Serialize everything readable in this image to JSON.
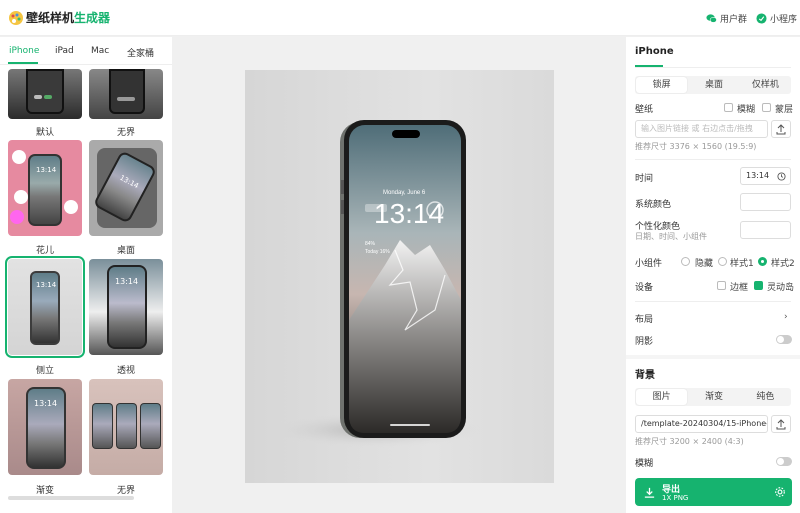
{
  "app": {
    "title_a": "壁纸样机",
    "title_b": "生成器",
    "user_group": "用户群",
    "mini_program": "小程序"
  },
  "device_tabs": [
    "iPhone",
    "iPad",
    "Mac",
    "全家桶"
  ],
  "templates": [
    {
      "label": "默认"
    },
    {
      "label": "无界"
    },
    {
      "label": "花儿"
    },
    {
      "label": "桌面"
    },
    {
      "label": "侧立"
    },
    {
      "label": "透视"
    },
    {
      "label": "渐变"
    },
    {
      "label": "无界"
    }
  ],
  "phone": {
    "date": "Monday, June 6",
    "time": "13:14",
    "battery": "84%",
    "weather": "Today 16%"
  },
  "thumb_time": "13:14",
  "panel": {
    "title": "iPhone",
    "modes": [
      "锁屏",
      "桌面",
      "仅样机"
    ],
    "wallpaper_label": "壁纸",
    "blur_label": "模糊",
    "mask_label": "蒙层",
    "wallpaper_placeholder": "输入图片链接 或 右边点击/拖拽",
    "wallpaper_hint": "推荐尺寸 3376 × 1560 (19.5:9)",
    "time_label": "时间",
    "time_value": "13:14",
    "system_color_label": "系统颜色",
    "custom_color_label": "个性化颜色",
    "custom_color_sub": "日期、时间、小组件",
    "widget_label": "小组件",
    "widget_options": [
      "隐藏",
      "样式1",
      "样式2"
    ],
    "device_label": "设备",
    "frame_label": "边框",
    "island_label": "灵动岛",
    "layout_label": "布局",
    "shadow_label": "阴影",
    "bg_title": "背景",
    "bg_modes": [
      "图片",
      "渐变",
      "纯色"
    ],
    "bg_value": "/template-20240304/15-iPhone-",
    "bg_hint": "推荐尺寸 3200 × 2400 (4:3)",
    "bg_blur_label": "模糊",
    "export_label": "导出",
    "export_sub": "1X PNG"
  },
  "colors": {
    "accent": "#16b36f"
  }
}
